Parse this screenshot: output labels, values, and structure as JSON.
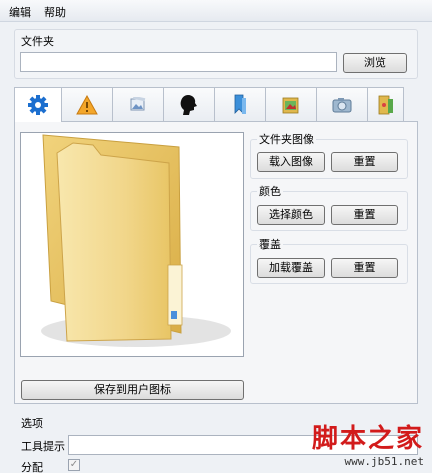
{
  "menu": {
    "edit": "编辑",
    "help": "帮助"
  },
  "folder": {
    "label": "文件夹",
    "path_value": "",
    "browse_label": "浏览"
  },
  "tabs": [
    {
      "icon": "gear-icon"
    },
    {
      "icon": "warning-icon"
    },
    {
      "icon": "picture-icon"
    },
    {
      "icon": "silhouette-icon"
    },
    {
      "icon": "bookmark-icon"
    },
    {
      "icon": "folder-image-icon"
    },
    {
      "icon": "camera-icon"
    },
    {
      "icon": "green-folder-icon"
    }
  ],
  "folder_image": {
    "title": "文件夹图像",
    "load_label": "载入图像",
    "reset_label": "重置"
  },
  "color": {
    "title": "颜色",
    "choose_label": "选择颜色",
    "reset_label": "重置"
  },
  "overlay": {
    "title": "覆盖",
    "load_label": "加载覆盖",
    "reset_label": "重置"
  },
  "save_user_icon_label": "保存到用户图标",
  "options": {
    "title": "选项",
    "tooltip_label": "工具提示",
    "tooltip_value": "",
    "assign_label": "分配",
    "assign_checked": true
  },
  "watermark": {
    "title": "脚本之家",
    "url": "www.jb51.net"
  }
}
